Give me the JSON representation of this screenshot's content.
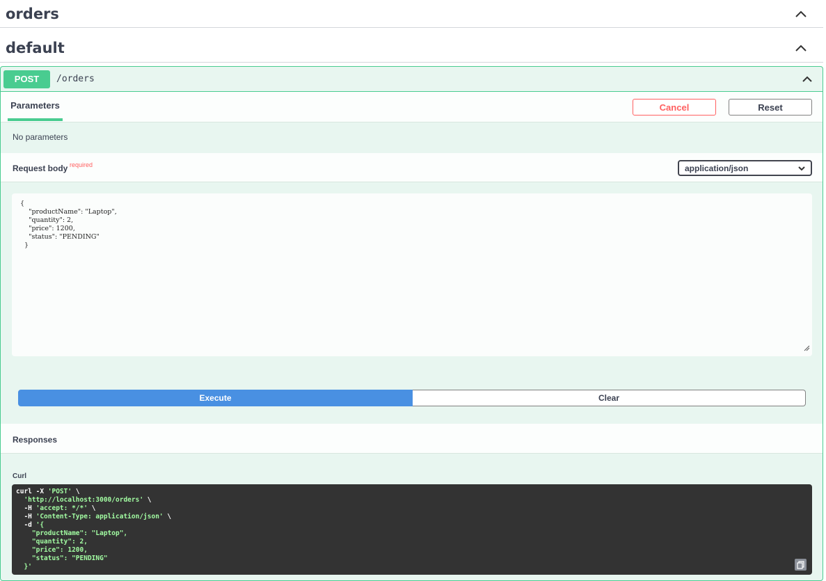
{
  "tags": [
    {
      "name": "orders"
    },
    {
      "name": "default"
    }
  ],
  "operation": {
    "method": "POST",
    "path": "/orders",
    "accent_color": "#49cc90"
  },
  "parameters": {
    "tab_label": "Parameters",
    "cancel_label": "Cancel",
    "reset_label": "Reset",
    "empty_text": "No parameters"
  },
  "request_body": {
    "title": "Request body",
    "required_label": "required",
    "content_type": "application/json",
    "editor_lines": [
      "{",
      "    \"productName\": \"Laptop\",",
      "    \"quantity\": 2,",
      "    \"price\": 1200,",
      "    \"status\": \"PENDING\"",
      "  }"
    ]
  },
  "actions": {
    "execute_label": "Execute",
    "clear_label": "Clear",
    "execute_color": "#4990e2"
  },
  "responses": {
    "title": "Responses",
    "curl_label": "Curl",
    "curl_lines": [
      {
        "plain": "curl -X ",
        "str": "'POST'",
        "tail": " \\"
      },
      {
        "plain": "  ",
        "str": "'http://localhost:3000/orders'",
        "tail": " \\"
      },
      {
        "plain": "  -H ",
        "str": "'accept: */*'",
        "tail": " \\"
      },
      {
        "plain": "  -H ",
        "str": "'Content-Type: application/json'",
        "tail": " \\"
      },
      {
        "plain": "  -d ",
        "str": "'{",
        "tail": ""
      },
      {
        "plain": "",
        "str": "    \"productName\": \"Laptop\",",
        "tail": ""
      },
      {
        "plain": "",
        "str": "    \"quantity\": 2,",
        "tail": ""
      },
      {
        "plain": "",
        "str": "    \"price\": 1200,",
        "tail": ""
      },
      {
        "plain": "",
        "str": "    \"status\": \"PENDING\"",
        "tail": ""
      },
      {
        "plain": "",
        "str": "  }'",
        "tail": ""
      }
    ]
  },
  "icons": [
    "chevron-up-icon",
    "chevron-down-icon",
    "resize-handle-icon",
    "copy-icon"
  ]
}
